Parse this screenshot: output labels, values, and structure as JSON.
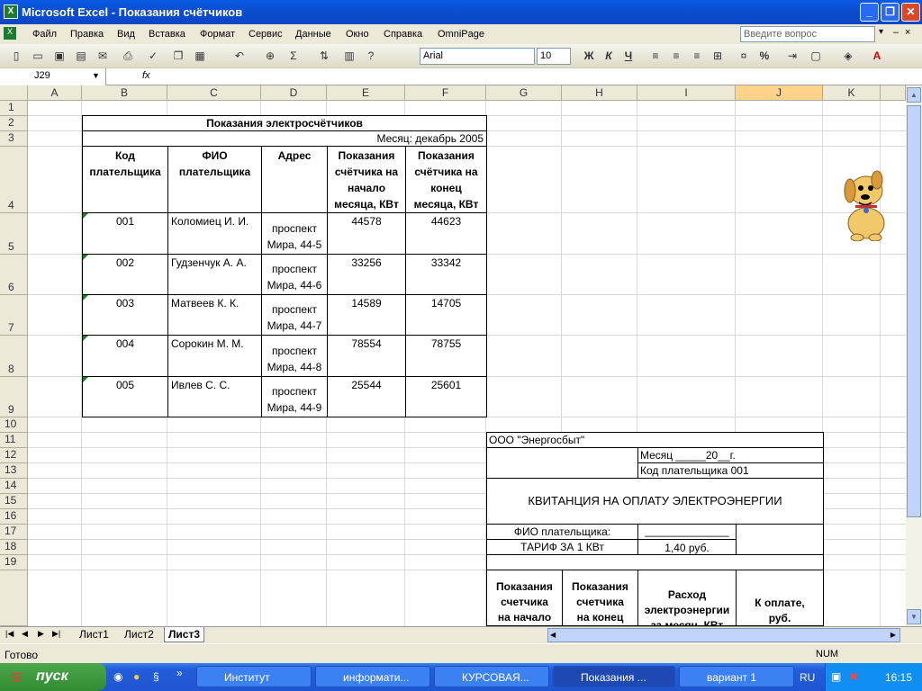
{
  "app": {
    "title": "Microsoft Excel - Показания счётчиков"
  },
  "window_controls": {
    "min": "_",
    "max": "❐",
    "close": "✕"
  },
  "menu": {
    "items": [
      "Файл",
      "Правка",
      "Вид",
      "Вставка",
      "Формат",
      "Сервис",
      "Данные",
      "Окно",
      "Справка",
      "OmniPage"
    ],
    "ask_placeholder": "Введите вопрос"
  },
  "toolbar": {
    "font": "Arial",
    "size": "10",
    "bold": "Ж",
    "italic": "К",
    "underline": "Ч",
    "percent": "%"
  },
  "formula": {
    "namebox": "J29",
    "fx": "fx",
    "value": ""
  },
  "columns": [
    "A",
    "B",
    "C",
    "D",
    "E",
    "F",
    "G",
    "H",
    "I",
    "J",
    "K"
  ],
  "rows": [
    "1",
    "2",
    "3",
    "4",
    "5",
    "6",
    "7",
    "8",
    "9",
    "10",
    "11",
    "12",
    "13",
    "14",
    "15",
    "16",
    "17",
    "18",
    "19"
  ],
  "table": {
    "title": "Показания электросчётчиков",
    "month": "Месяц: декабрь 2005",
    "headers": [
      "Код\nплательщика",
      "ФИО\nплательщика",
      "Адрес",
      "Показания\nсчётчика на\nначало\nмесяца, КВт",
      "Показания\nсчётчика на\nконец\nмесяца, КВт"
    ],
    "rows": [
      {
        "code": "001",
        "name": "Коломиец И. И.",
        "addr": "проспект\nМира, 44-5",
        "start": "44578",
        "end": "44623"
      },
      {
        "code": "002",
        "name": "Гудзенчук А. А.",
        "addr": "проспект\nМира, 44-6",
        "start": "33256",
        "end": "33342"
      },
      {
        "code": "003",
        "name": "Матвеев К. К.",
        "addr": "проспект\nМира, 44-7",
        "start": "14589",
        "end": "14705"
      },
      {
        "code": "004",
        "name": "Сорокин М. М.",
        "addr": "проспект\nМира, 44-8",
        "start": "78554",
        "end": "78755"
      },
      {
        "code": "005",
        "name": "Ивлев С. С.",
        "addr": "проспект\nМира, 44-9",
        "start": "25544",
        "end": "25601"
      }
    ]
  },
  "receipt": {
    "company": "ООО \"Энергосбыт\"",
    "month": "Месяц _____20__г.",
    "payer_code": "Код плательщика 001",
    "title": "КВИТАНЦИЯ НА ОПЛАТУ ЭЛЕКТРОЭНЕРГИИ",
    "fio_label": "ФИО плательщика:",
    "fio_value": "______________",
    "tariff_label": "ТАРИФ ЗА 1 КВт",
    "tariff_value": "1,40 руб.",
    "headers": [
      "Показания\nсчетчика\nна начало",
      "Показания\nсчетчика\nна конец",
      "Расход\nэлектроэнергии\nза месяц, КВт",
      "К оплате,\nруб."
    ]
  },
  "sheet_tabs": [
    "Лист1",
    "Лист2",
    "Лист3"
  ],
  "status": {
    "left": "Готово",
    "num": "NUM"
  },
  "taskbar": {
    "start": "пуск",
    "tasks": [
      "Институт",
      "информати...",
      "КУРСОВАЯ...",
      "Показания ...",
      "вариант 1"
    ],
    "lang": "RU",
    "clock": "16:15"
  }
}
